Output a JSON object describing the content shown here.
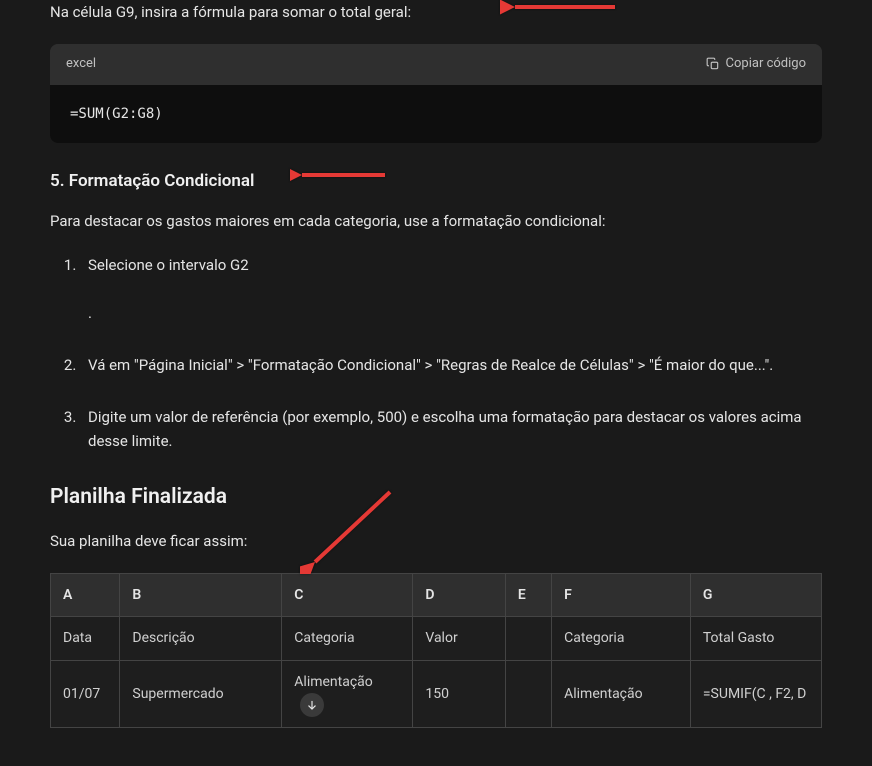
{
  "intro": "Na célula G9, insira a fórmula para somar o total geral:",
  "code": {
    "lang": "excel",
    "copy_label": "Copiar código",
    "content": "=SUM(G2:G8)"
  },
  "section5": {
    "heading": "5. Formatação Condicional",
    "desc": "Para destacar os gastos maiores em cada categoria, use a formatação condicional:",
    "steps": [
      "Selecione o intervalo G2",
      "Vá em \"Página Inicial\" > \"Formatação Condicional\" > \"Regras de Realce de Células\" > \"É maior do que...\".",
      "Digite um valor de referência (por exemplo, 500) e escolha uma formatação para destacar os valores acima desse limite."
    ],
    "step1_dot": "."
  },
  "finalized": {
    "heading": "Planilha Finalizada",
    "desc": "Sua planilha deve ficar assim:"
  },
  "table": {
    "headers": [
      "A",
      "B",
      "C",
      "D",
      "E",
      "F",
      "G"
    ],
    "rows": [
      [
        "Data",
        "Descrição",
        "Categoria",
        "Valor",
        "",
        "Categoria",
        "Total Gasto"
      ],
      [
        "01/07",
        "Supermercado",
        "Alimentação",
        "150",
        "",
        "Alimentação",
        "=SUMIF(C , F2, D"
      ]
    ]
  }
}
